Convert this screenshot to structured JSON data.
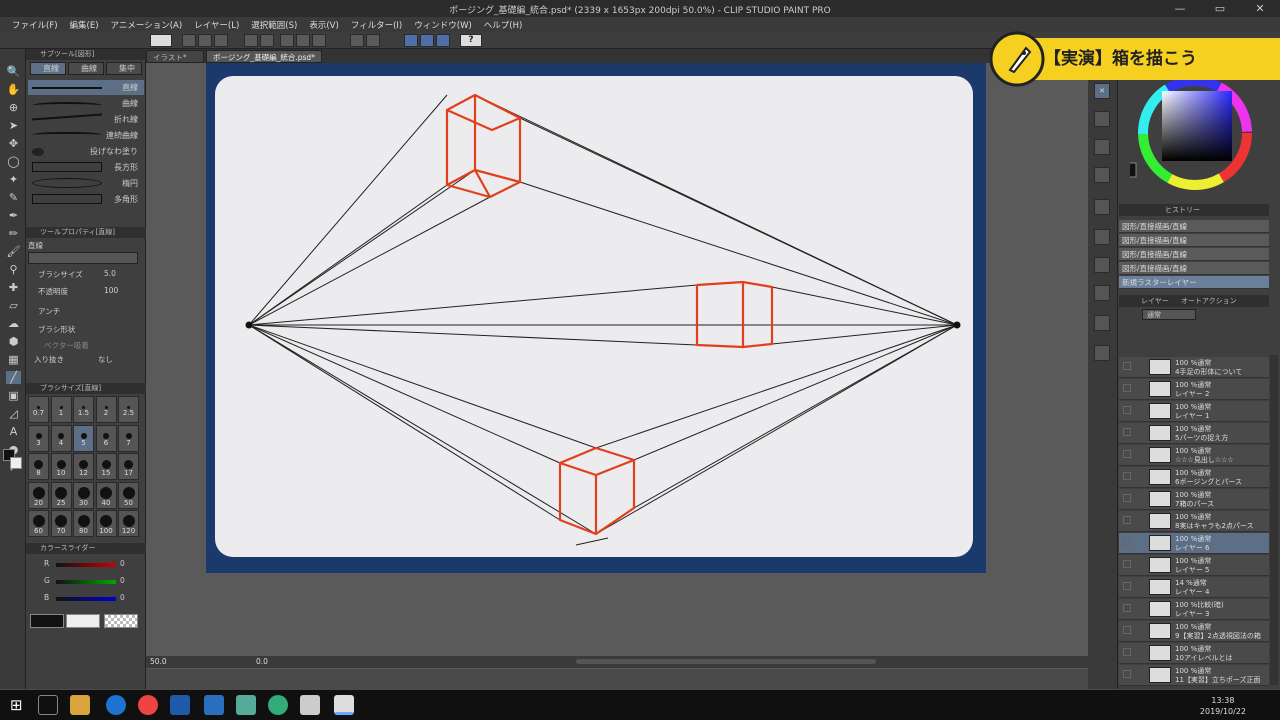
{
  "window": {
    "title": "ポージング_基礎編_統合.psd* (2339 x 1653px 200dpi 50.0%) - CLIP STUDIO PAINT PRO"
  },
  "menu": [
    "ファイル(F)",
    "編集(E)",
    "アニメーション(A)",
    "レイヤー(L)",
    "選択範囲(S)",
    "表示(V)",
    "フィルター(I)",
    "ウィンドウ(W)",
    "ヘルプ(H)"
  ],
  "subtool": {
    "header": "サブツール[図形]",
    "tabs": [
      "直線",
      "曲線",
      "集中"
    ],
    "items": [
      "直線",
      "曲線",
      "折れ線",
      "連続曲線",
      "投げなわ塗り",
      "長方形",
      "楕円",
      "多角形"
    ]
  },
  "toolprop": {
    "header": "ツールプロパティ[直線]",
    "name": "直線",
    "brush_size_label": "ブラシサイズ",
    "brush_size": "5.0",
    "opacity_label": "不透明度",
    "opacity": "100",
    "aa_label": "アンチ",
    "shape_label": "ブラシ形状",
    "vector_label": "ベクター吸着",
    "inout_label": "入り抜き",
    "inout_value": "なし"
  },
  "brushsize": {
    "header": "ブラシサイズ[直線]",
    "sizes": [
      "0.7",
      "1",
      "1.5",
      "2",
      "2.5",
      "3",
      "4",
      "5",
      "6",
      "7",
      "8",
      "10",
      "12",
      "15",
      "17",
      "20",
      "25",
      "30",
      "40",
      "50",
      "60",
      "70",
      "80",
      "100",
      "120"
    ]
  },
  "color": {
    "header": "カラースライダー",
    "r": "0",
    "g": "0",
    "b": "0",
    "main": "#111111",
    "sub": "#eeeeee"
  },
  "tabs": [
    "イラスト*",
    "ポージング_基礎編_統合.psd*"
  ],
  "zoom": "50.0",
  "coords": "0.0",
  "banner": {
    "text": "【実演】箱を描こう",
    "accent": "#f5d020"
  },
  "history": {
    "tab": "ヒストリー",
    "items": [
      "図形/直接描画/直線",
      "図形/直接描画/直線",
      "図形/直接描画/直線",
      "図形/直接描画/直線",
      "新規ラスターレイヤー"
    ]
  },
  "layerpanel": {
    "tab": "レイヤー",
    "tab2": "オートアクション",
    "blend": "通常"
  },
  "layers": [
    {
      "p": "100 %通常",
      "n": "4手足の形体について"
    },
    {
      "p": "100 %通常",
      "n": "レイヤー 2"
    },
    {
      "p": "100 %通常",
      "n": "レイヤー 1"
    },
    {
      "p": "100 %通常",
      "n": "5パーツの捉え方"
    },
    {
      "p": "100 %通常",
      "n": "☆☆☆見出し☆☆☆"
    },
    {
      "p": "100 %通常",
      "n": "6ポージングとパース"
    },
    {
      "p": "100 %通常",
      "n": "7箱のパース"
    },
    {
      "p": "100 %通常",
      "n": "8実はキャラも2点パース"
    },
    {
      "p": "100 %通常",
      "n": "レイヤー 6"
    },
    {
      "p": "100 %通常",
      "n": "レイヤー 5"
    },
    {
      "p": "14 %通常",
      "n": "レイヤー 4"
    },
    {
      "p": "100 %比較(暗)",
      "n": "レイヤー 3"
    },
    {
      "p": "100 %通常",
      "n": "9【実習】2点透視図法の箱"
    },
    {
      "p": "100 %通常",
      "n": "10アイレベルとは"
    },
    {
      "p": "100 %通常",
      "n": "11【実習】立ちポーズ正面"
    }
  ],
  "clock": {
    "time": "13:38",
    "date": "2019/10/22"
  },
  "colors": {
    "box": "#e0401c",
    "guide": "#222222"
  }
}
